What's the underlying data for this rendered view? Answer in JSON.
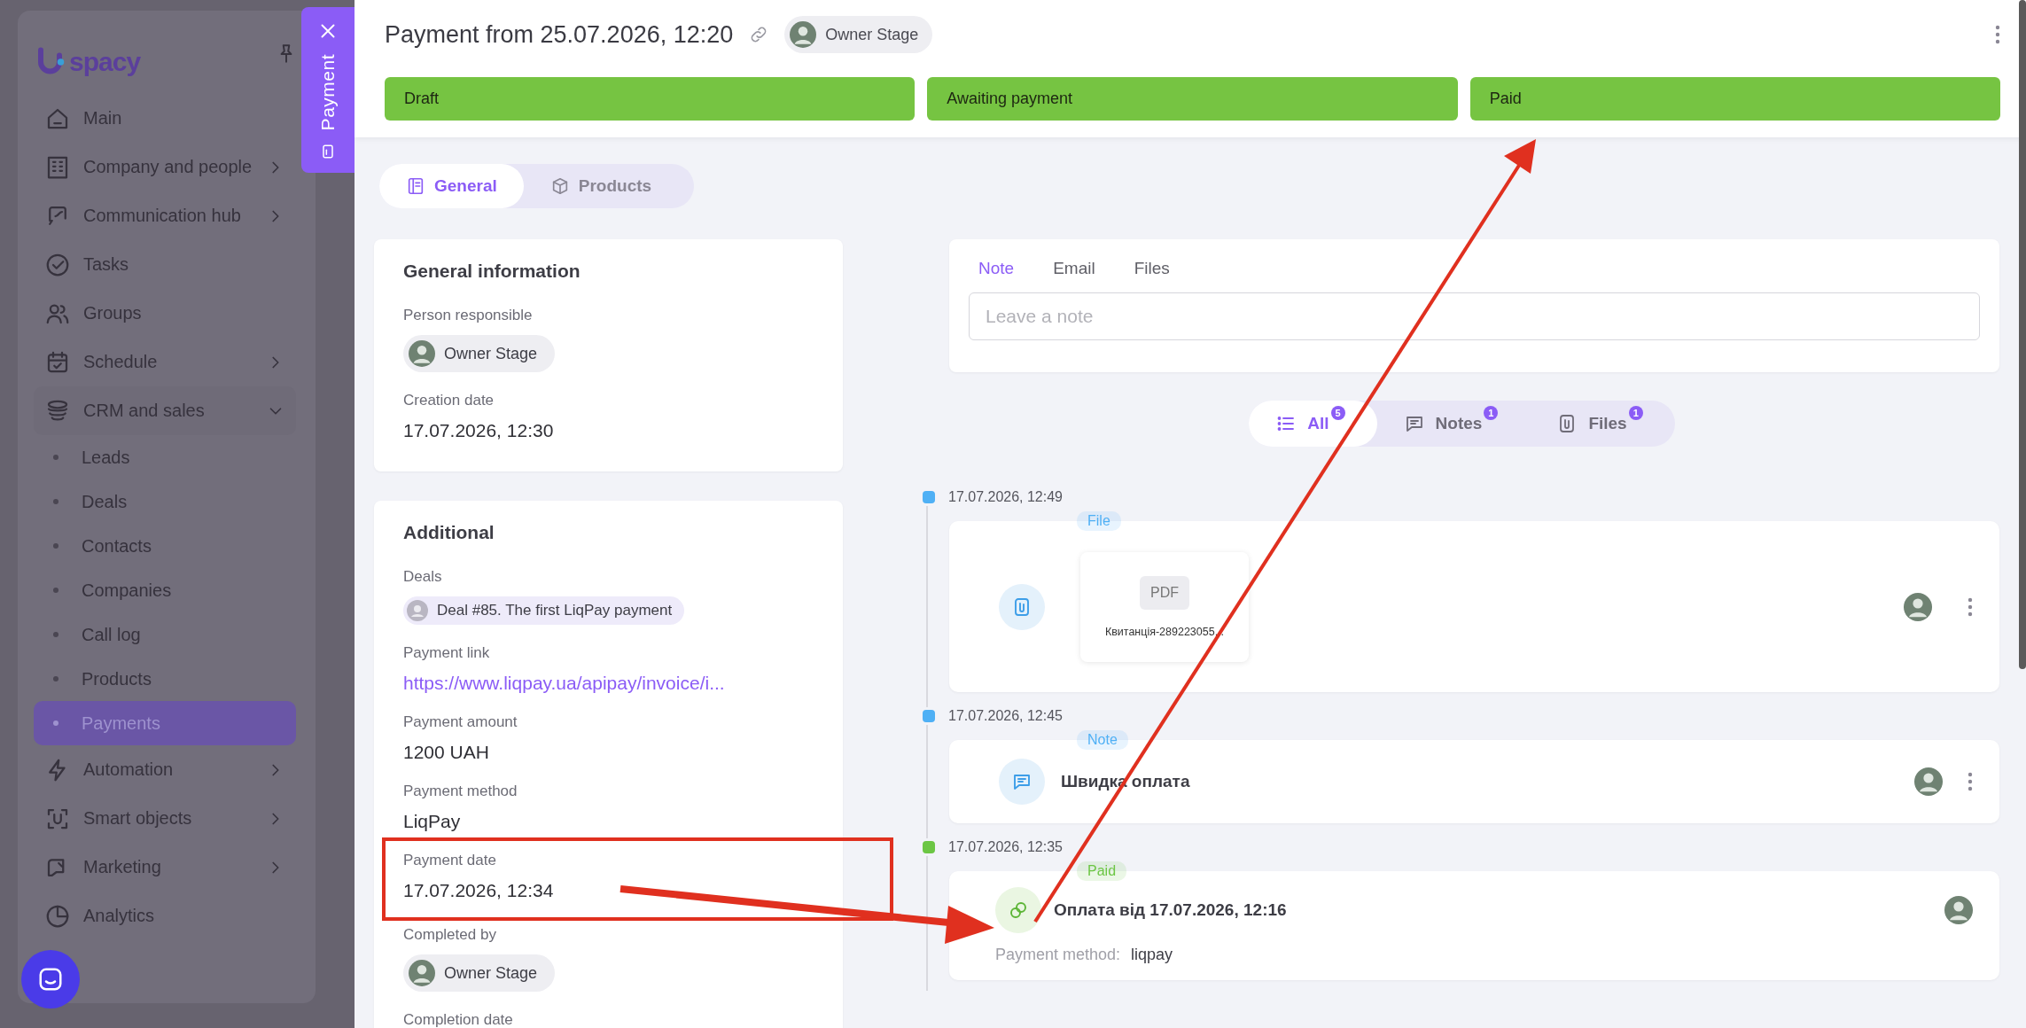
{
  "sidebar": {
    "logo": "spacy",
    "items": [
      {
        "label": "Main",
        "kind": "link"
      },
      {
        "label": "Company and people",
        "kind": "group",
        "expanded": false
      },
      {
        "label": "Communication hub",
        "kind": "group",
        "expanded": false
      },
      {
        "label": "Tasks",
        "kind": "link"
      },
      {
        "label": "Groups",
        "kind": "link"
      },
      {
        "label": "Schedule",
        "kind": "group",
        "expanded": false
      },
      {
        "label": "CRM and sales",
        "kind": "group",
        "expanded": true,
        "children": [
          {
            "label": "Leads",
            "selected": false
          },
          {
            "label": "Deals",
            "selected": false
          },
          {
            "label": "Contacts",
            "selected": false
          },
          {
            "label": "Companies",
            "selected": false
          },
          {
            "label": "Call log",
            "selected": false
          },
          {
            "label": "Products",
            "selected": false
          },
          {
            "label": "Payments",
            "selected": true
          }
        ]
      },
      {
        "label": "Automation",
        "kind": "group",
        "expanded": false
      },
      {
        "label": "Smart objects",
        "kind": "group",
        "expanded": false
      },
      {
        "label": "Marketing",
        "kind": "group",
        "expanded": false
      },
      {
        "label": "Analytics",
        "kind": "link"
      }
    ]
  },
  "side_tab": {
    "label": "Payment"
  },
  "header": {
    "title": "Payment from 25.07.2026, 12:20",
    "owner": "Owner Stage",
    "stages": [
      {
        "label": "Draft",
        "passed": true
      },
      {
        "label": "Awaiting payment",
        "passed": true
      },
      {
        "label": "Paid",
        "passed": true
      }
    ]
  },
  "tabs": [
    {
      "label": "General",
      "selected": true
    },
    {
      "label": "Products",
      "selected": false
    }
  ],
  "cards": [
    {
      "title": "General information",
      "fields": [
        {
          "label": "Person responsible",
          "kind": "person",
          "value": "Owner Stage"
        },
        {
          "label": "Creation date",
          "kind": "text",
          "value": "17.07.2026, 12:30"
        }
      ]
    },
    {
      "title": "Additional",
      "fields": [
        {
          "label": "Deals",
          "kind": "deal",
          "value": "Deal #85. The first LiqPay payment"
        },
        {
          "label": "Payment link",
          "kind": "link",
          "value": "https://www.liqpay.ua/apipay/invoice/i..."
        },
        {
          "label": "Payment amount",
          "kind": "text",
          "value": "1200 UAH"
        },
        {
          "label": "Payment method",
          "kind": "text",
          "value": "LiqPay"
        },
        {
          "label": "Payment date",
          "kind": "text",
          "value": "17.07.2026, 12:34",
          "annotated": true
        },
        {
          "label": "Completed by",
          "kind": "person",
          "value": "Owner Stage"
        },
        {
          "label": "Completion date",
          "kind": "label"
        }
      ]
    }
  ],
  "composer": {
    "tabs": [
      {
        "label": "Note",
        "selected": true
      },
      {
        "label": "Email",
        "selected": false
      },
      {
        "label": "Files",
        "selected": false
      }
    ],
    "placeholder": "Leave a note"
  },
  "filters": [
    {
      "label": "All",
      "count": "5",
      "selected": true
    },
    {
      "label": "Notes",
      "count": "1",
      "selected": false
    },
    {
      "label": "Files",
      "count": "1",
      "selected": false
    }
  ],
  "timeline": [
    {
      "time": "17.07.2026, 12:49",
      "color": "#4fb0f5",
      "tag": "File",
      "kind": "file",
      "badge": "PDF",
      "file_name": "Квитанція-289223055..."
    },
    {
      "time": "17.07.2026, 12:45",
      "color": "#4fb0f5",
      "tag": "Note",
      "kind": "note",
      "text": "Швидка оплата"
    },
    {
      "time": "17.07.2026, 12:35",
      "color": "#6cc644",
      "tag": "Paid",
      "kind": "payment",
      "text": "Оплата від 17.07.2026, 12:16",
      "detail_label": "Payment method:",
      "detail_value": "liqpay"
    }
  ]
}
